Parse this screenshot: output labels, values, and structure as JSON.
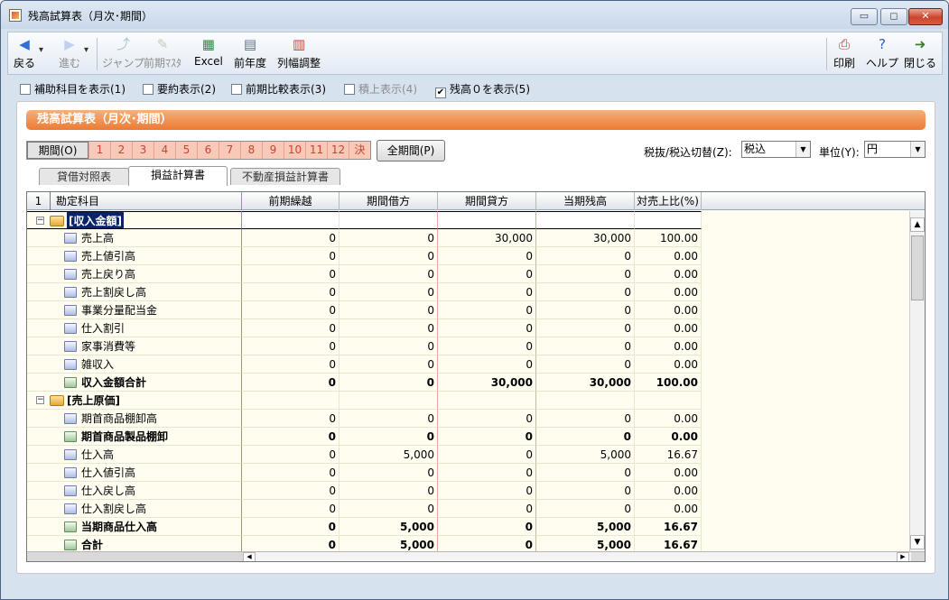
{
  "window": {
    "title": "残高試算表（月次･期間）",
    "controls": {
      "minimize": "▭",
      "maximize": "◻",
      "close": "✕"
    }
  },
  "toolbar": [
    {
      "label": "戻る",
      "icon": "back-arrow-icon",
      "glyph": "◀",
      "color": "#2f6fd6",
      "enabled": true,
      "dropdown": true
    },
    {
      "label": "進む",
      "icon": "forward-arrow-icon",
      "glyph": "▶",
      "color": "#7ea5e3",
      "enabled": false,
      "dropdown": true
    },
    {
      "label": "ジャンプ",
      "icon": "jump-icon",
      "glyph": "⤴",
      "color": "#5d7db0",
      "enabled": false
    },
    {
      "label": "前期ﾏｽﾀ",
      "icon": "previous-master-icon",
      "glyph": "✎",
      "color": "#9b8b6a",
      "enabled": false
    },
    {
      "label": "Excel",
      "icon": "excel-icon",
      "glyph": "▦",
      "color": "#2f8a3c",
      "enabled": true
    },
    {
      "label": "前年度",
      "icon": "previous-year-icon",
      "glyph": "▤",
      "color": "#5c6f8f",
      "enabled": true
    },
    {
      "label": "列幅調整",
      "icon": "column-width-icon",
      "glyph": "▥",
      "color": "#c24a3d",
      "enabled": true
    },
    {
      "label": "印刷",
      "icon": "print-icon",
      "glyph": "⎙",
      "color": "#b0413a",
      "enabled": true
    },
    {
      "label": "ヘルプ",
      "icon": "help-icon",
      "glyph": "?",
      "color": "#2b5fb8",
      "enabled": true
    },
    {
      "label": "閉じる",
      "icon": "close-door-icon",
      "glyph": "➜",
      "color": "#3d7c2c",
      "enabled": true
    }
  ],
  "options": [
    {
      "label": "補助科目を表示(1)",
      "checked": false,
      "enabled": true
    },
    {
      "label": "要約表示(2)",
      "checked": false,
      "enabled": true
    },
    {
      "label": "前期比較表示(3)",
      "checked": false,
      "enabled": true
    },
    {
      "label": "積上表示(4)",
      "checked": false,
      "enabled": false
    },
    {
      "label": "残高０を表示(5)",
      "checked": true,
      "enabled": true
    }
  ],
  "banner": {
    "title": "残高試算表（月次･期間）"
  },
  "periods": {
    "label": "期間(O)",
    "months": [
      "1",
      "2",
      "3",
      "4",
      "5",
      "6",
      "7",
      "8",
      "9",
      "10",
      "11",
      "12",
      "決"
    ],
    "all_button": "全期間(P)"
  },
  "tax": {
    "label": "税抜/税込切替(Z):",
    "value": "税込"
  },
  "unit": {
    "label": "単位(Y):",
    "value": "円"
  },
  "tabs": [
    "貸借対照表",
    "損益計算書",
    "不動産損益計算書"
  ],
  "active_tab": 1,
  "grid": {
    "columns": [
      "1",
      "勘定科目",
      "前期繰越",
      "期間借方",
      "期間貸方",
      "当期残高",
      "対売上比(%)"
    ],
    "rows": [
      {
        "type": "group",
        "name": "[収入金額]",
        "selected": true
      },
      {
        "type": "item",
        "name": "売上高",
        "values": [
          "0",
          "0",
          "30,000",
          "30,000",
          "100.00"
        ]
      },
      {
        "type": "item",
        "name": "売上値引高",
        "values": [
          "0",
          "0",
          "0",
          "0",
          "0.00"
        ]
      },
      {
        "type": "item",
        "name": "売上戻り高",
        "values": [
          "0",
          "0",
          "0",
          "0",
          "0.00"
        ]
      },
      {
        "type": "item",
        "name": "売上割戻し高",
        "values": [
          "0",
          "0",
          "0",
          "0",
          "0.00"
        ]
      },
      {
        "type": "item",
        "name": "事業分量配当金",
        "values": [
          "0",
          "0",
          "0",
          "0",
          "0.00"
        ]
      },
      {
        "type": "item",
        "name": "仕入割引",
        "values": [
          "0",
          "0",
          "0",
          "0",
          "0.00"
        ]
      },
      {
        "type": "item",
        "name": "家事消費等",
        "values": [
          "0",
          "0",
          "0",
          "0",
          "0.00"
        ]
      },
      {
        "type": "item",
        "name": "雑収入",
        "values": [
          "0",
          "0",
          "0",
          "0",
          "0.00"
        ]
      },
      {
        "type": "total",
        "name": "収入金額合計",
        "values": [
          "0",
          "0",
          "30,000",
          "30,000",
          "100.00"
        ]
      },
      {
        "type": "group",
        "name": "[売上原価]",
        "selected": false
      },
      {
        "type": "item",
        "name": "期首商品棚卸高",
        "values": [
          "0",
          "0",
          "0",
          "0",
          "0.00"
        ]
      },
      {
        "type": "total",
        "name": "期首商品製品棚卸",
        "values": [
          "0",
          "0",
          "0",
          "0",
          "0.00"
        ]
      },
      {
        "type": "item",
        "name": "仕入高",
        "values": [
          "0",
          "5,000",
          "0",
          "5,000",
          "16.67"
        ]
      },
      {
        "type": "item",
        "name": "仕入値引高",
        "values": [
          "0",
          "0",
          "0",
          "0",
          "0.00"
        ]
      },
      {
        "type": "item",
        "name": "仕入戻し高",
        "values": [
          "0",
          "0",
          "0",
          "0",
          "0.00"
        ]
      },
      {
        "type": "item",
        "name": "仕入割戻し高",
        "values": [
          "0",
          "0",
          "0",
          "0",
          "0.00"
        ]
      },
      {
        "type": "total",
        "name": "当期商品仕入高",
        "values": [
          "0",
          "5,000",
          "0",
          "5,000",
          "16.67"
        ]
      },
      {
        "type": "total",
        "name": "合計",
        "values": [
          "0",
          "5,000",
          "0",
          "5,000",
          "16.67"
        ]
      }
    ]
  }
}
